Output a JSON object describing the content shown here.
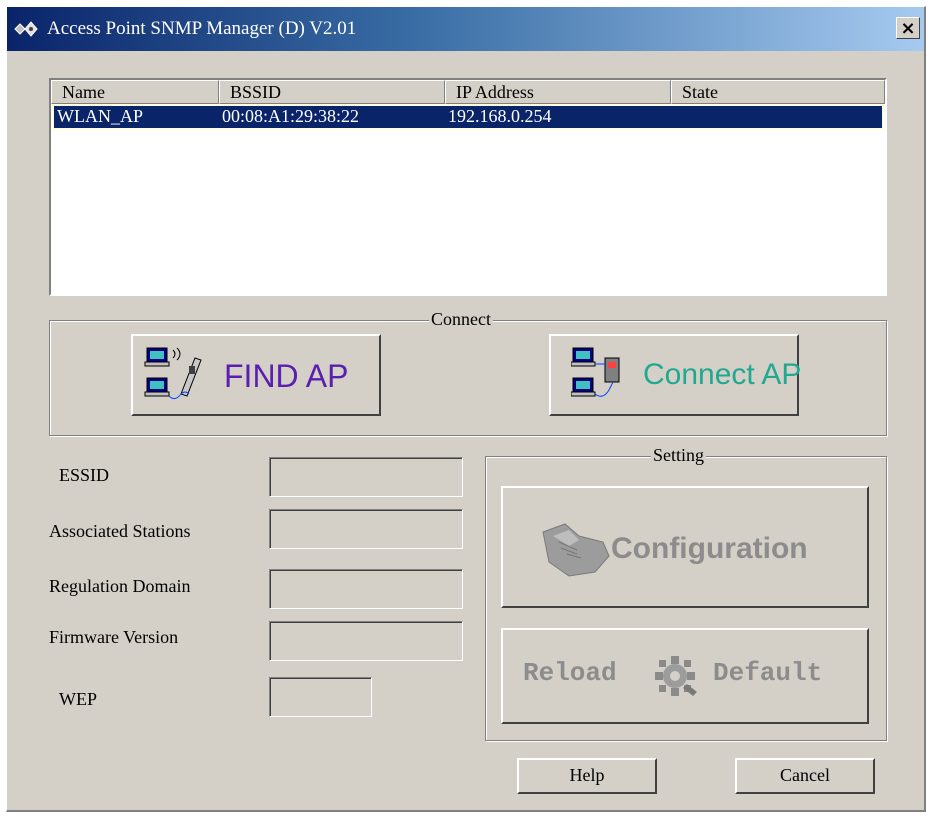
{
  "window": {
    "title": "Access Point SNMP Manager (D) V2.01",
    "close_glyph": "×"
  },
  "ap_list": {
    "columns": [
      "Name",
      "BSSID",
      "IP Address",
      "State"
    ],
    "rows": [
      {
        "name": "WLAN_AP",
        "bssid": "00:08:A1:29:38:22",
        "ip": "192.168.0.254",
        "state": "",
        "selected": true
      }
    ]
  },
  "connect_group": {
    "label": "Connect",
    "find_ap_label": "FIND AP",
    "connect_ap_label": "Connect AP",
    "find_ap_color": "#5a1fb0",
    "connect_ap_color": "#20a890"
  },
  "info_fields": {
    "essid_label": "ESSID",
    "associated_stations_label": "Associated Stations",
    "regulation_domain_label": "Regulation Domain",
    "firmware_version_label": "Firmware Version",
    "wep_label": "WEP",
    "essid_value": "",
    "associated_stations_value": "",
    "regulation_domain_value": "",
    "firmware_version_value": "",
    "wep_value": ""
  },
  "setting_group": {
    "label": "Setting",
    "configuration_label": "Configuration",
    "reload_label": "Reload",
    "default_label": "Default",
    "disabled_text_color": "#8c8c8c"
  },
  "footer": {
    "help_label": "Help",
    "cancel_label": "Cancel"
  },
  "icons": [
    "app-icon",
    "close-icon",
    "wireless-pc-icon",
    "network-pc-icon",
    "hand-tool-icon",
    "gear-reload-icon"
  ]
}
